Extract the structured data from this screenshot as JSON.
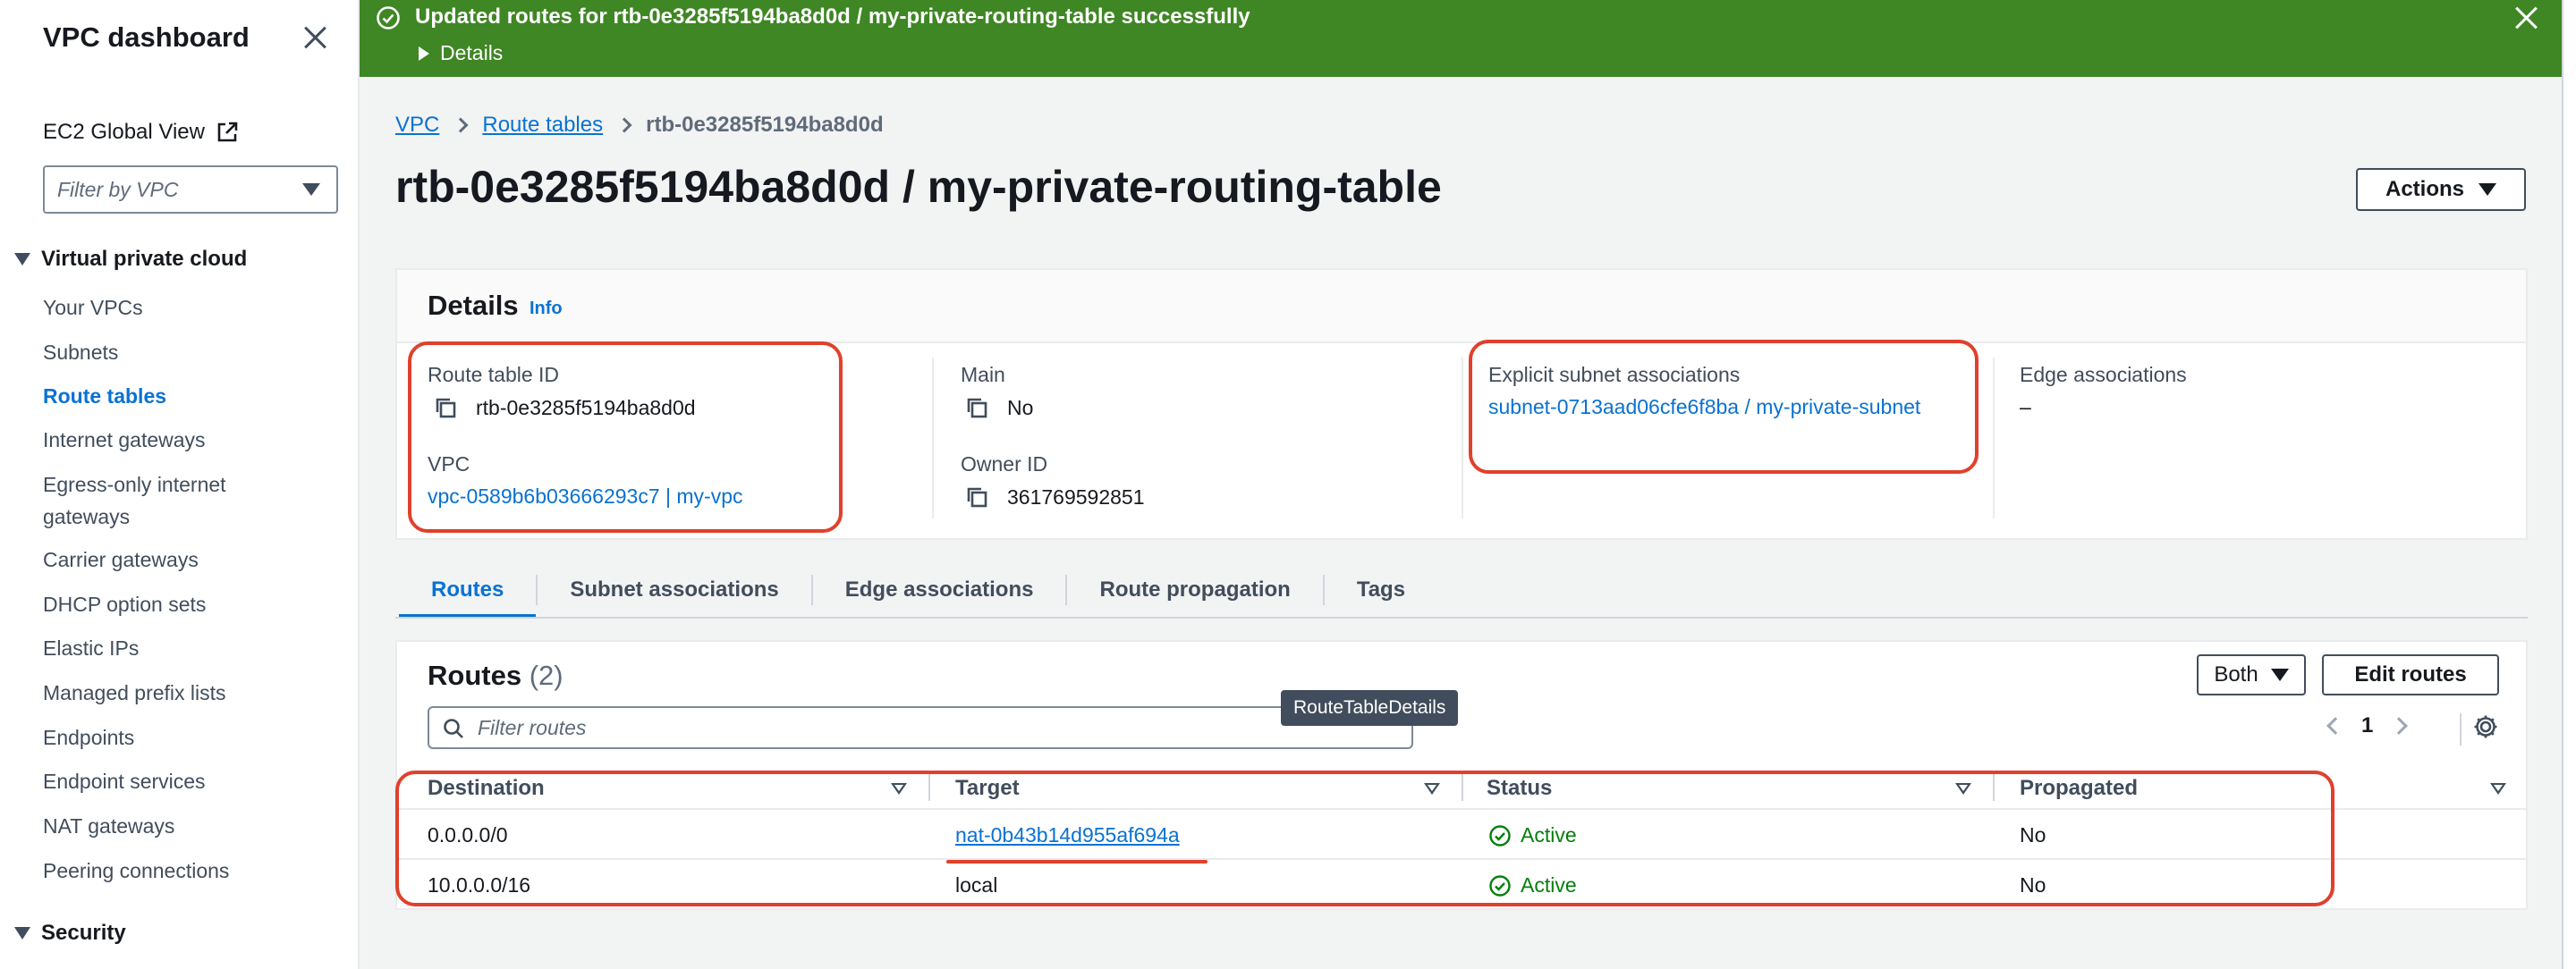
{
  "sidebar": {
    "title": "VPC dashboard",
    "ec2_global_view": "EC2 Global View",
    "filter_placeholder": "Filter by VPC",
    "section_vpc": "Virtual private cloud",
    "items": [
      {
        "label": "Your VPCs"
      },
      {
        "label": "Subnets"
      },
      {
        "label": "Route tables"
      },
      {
        "label": "Internet gateways"
      },
      {
        "label": "Egress-only internet gateways"
      },
      {
        "label": "Carrier gateways"
      },
      {
        "label": "DHCP option sets"
      },
      {
        "label": "Elastic IPs"
      },
      {
        "label": "Managed prefix lists"
      },
      {
        "label": "Endpoints"
      },
      {
        "label": "Endpoint services"
      },
      {
        "label": "NAT gateways"
      },
      {
        "label": "Peering connections"
      }
    ],
    "active_item": "Route tables",
    "section_security": "Security"
  },
  "flash": {
    "message": "Updated routes for rtb-0e3285f5194ba8d0d / my-private-routing-table successfully",
    "details_label": "Details"
  },
  "breadcrumb": {
    "vpc": "VPC",
    "route_tables": "Route tables",
    "current": "rtb-0e3285f5194ba8d0d"
  },
  "page": {
    "title": "rtb-0e3285f5194ba8d0d / my-private-routing-table",
    "actions_label": "Actions"
  },
  "details": {
    "title": "Details",
    "info": "Info",
    "route_table_id_label": "Route table ID",
    "route_table_id": "rtb-0e3285f5194ba8d0d",
    "vpc_label": "VPC",
    "vpc_value": "vpc-0589b6b03666293c7 | my-vpc",
    "main_label": "Main",
    "main_value": "No",
    "owner_label": "Owner ID",
    "owner_value": "361769592851",
    "explicit_label": "Explicit subnet associations",
    "explicit_value": "subnet-0713aad06cfe6f8ba / my-private-subnet",
    "edge_label": "Edge associations",
    "edge_value": "–"
  },
  "tabs": [
    {
      "label": "Routes"
    },
    {
      "label": "Subnet associations"
    },
    {
      "label": "Edge associations"
    },
    {
      "label": "Route propagation"
    },
    {
      "label": "Tags"
    }
  ],
  "routes": {
    "title": "Routes",
    "count": "(2)",
    "filter_placeholder": "Filter routes",
    "tooltip": "RouteTableDetails",
    "both_label": "Both",
    "edit_label": "Edit routes",
    "page_number": "1",
    "columns": [
      "Destination",
      "Target",
      "Status",
      "Propagated"
    ],
    "rows": [
      {
        "destination": "0.0.0.0/0",
        "target": "nat-0b43b14d955af694a",
        "status": "Active",
        "propagated": "No"
      },
      {
        "destination": "10.0.0.0/16",
        "target": "local",
        "status": "Active",
        "propagated": "No"
      }
    ]
  },
  "colors": {
    "success_green": "#3f8624",
    "link_blue": "#0972d3",
    "status_green": "#037f0c",
    "annotation_red": "#e0402c"
  }
}
